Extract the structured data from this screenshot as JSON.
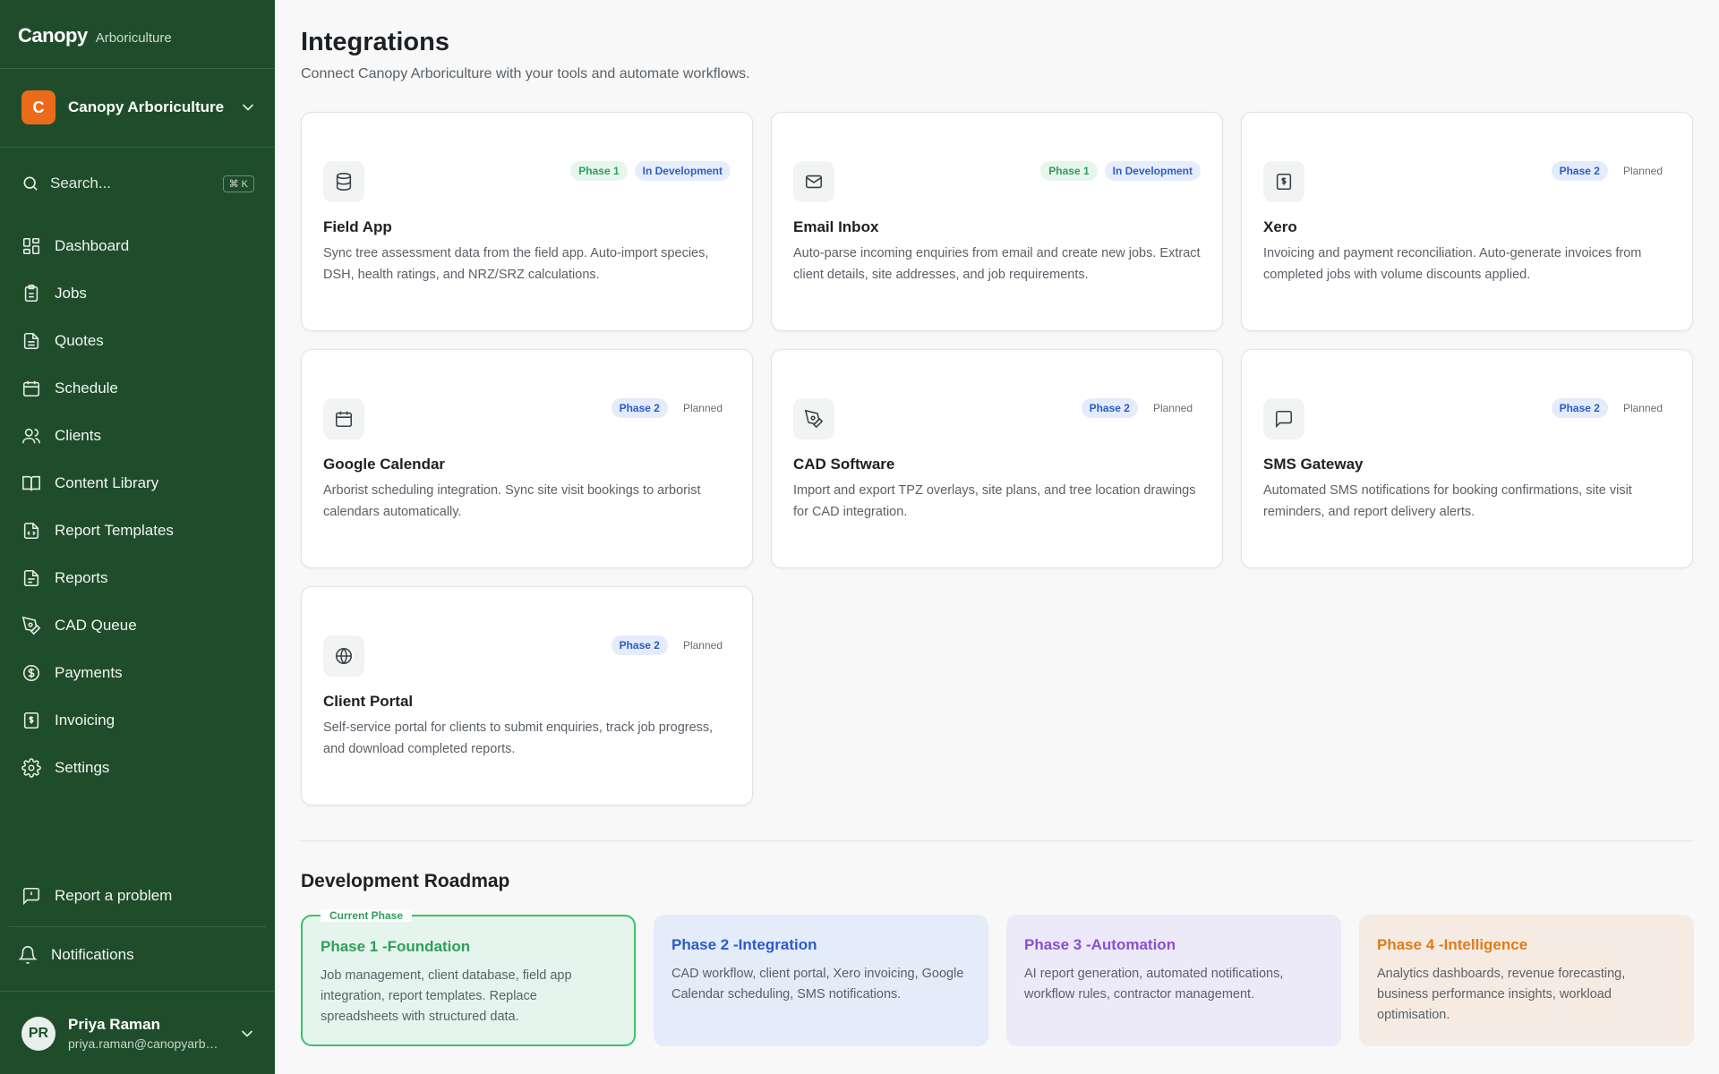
{
  "brand": {
    "name": "Canopy",
    "sub": "Arboriculture"
  },
  "org": {
    "initial": "C",
    "name": "Canopy Arboriculture"
  },
  "search": {
    "label": "Search...",
    "shortcut": "⌘ K"
  },
  "nav": [
    {
      "label": "Dashboard",
      "icon": "grid-icon"
    },
    {
      "label": "Jobs",
      "icon": "clipboard-icon"
    },
    {
      "label": "Quotes",
      "icon": "document-icon"
    },
    {
      "label": "Schedule",
      "icon": "calendar-icon"
    },
    {
      "label": "Clients",
      "icon": "users-icon"
    },
    {
      "label": "Content Library",
      "icon": "book-icon"
    },
    {
      "label": "Report Templates",
      "icon": "file-code-icon"
    },
    {
      "label": "Reports",
      "icon": "file-text-icon"
    },
    {
      "label": "CAD Queue",
      "icon": "pen-tool-icon"
    },
    {
      "label": "Payments",
      "icon": "dollar-circle-icon"
    },
    {
      "label": "Invoicing",
      "icon": "invoice-icon"
    },
    {
      "label": "Settings",
      "icon": "gear-icon"
    }
  ],
  "sidebar_footer": {
    "report_problem": "Report a problem",
    "notifications": "Notifications"
  },
  "user": {
    "initials": "PR",
    "name": "Priya Raman",
    "email": "priya.raman@canopyarboriculture.com"
  },
  "page": {
    "title": "Integrations",
    "subtitle": "Connect Canopy Arboriculture with your tools and automate workflows."
  },
  "integrations": [
    {
      "title": "Field App",
      "icon": "database-icon",
      "phase": "Phase 1",
      "status": "In Development",
      "desc": "Sync tree assessment data from the field app. Auto-import species, DSH, health ratings, and NRZ/SRZ calculations."
    },
    {
      "title": "Email Inbox",
      "icon": "mail-icon",
      "phase": "Phase 1",
      "status": "In Development",
      "desc": "Auto-parse incoming enquiries from email and create new jobs. Extract client details, site addresses, and job requirements."
    },
    {
      "title": "Xero",
      "icon": "invoice-icon",
      "phase": "Phase 2",
      "status": "Planned",
      "desc": "Invoicing and payment reconciliation. Auto-generate invoices from completed jobs with volume discounts applied."
    },
    {
      "title": "Google Calendar",
      "icon": "calendar-icon",
      "phase": "Phase 2",
      "status": "Planned",
      "desc": "Arborist scheduling integration. Sync site visit bookings to arborist calendars automatically."
    },
    {
      "title": "CAD Software",
      "icon": "pen-tool-icon",
      "phase": "Phase 2",
      "status": "Planned",
      "desc": "Import and export TPZ overlays, site plans, and tree location drawings for CAD integration."
    },
    {
      "title": "SMS Gateway",
      "icon": "message-icon",
      "phase": "Phase 2",
      "status": "Planned",
      "desc": "Automated SMS notifications for booking confirmations, site visit reminders, and report delivery alerts."
    },
    {
      "title": "Client Portal",
      "icon": "globe-icon",
      "phase": "Phase 2",
      "status": "Planned",
      "desc": "Self-service portal for clients to submit enquiries, track job progress, and download completed reports."
    }
  ],
  "roadmap": {
    "title": "Development Roadmap",
    "current_tag": "Current Phase",
    "phases": [
      {
        "title": "Phase 1 -Foundation",
        "desc": "Job management, client database, field app integration, report templates. Replace spreadsheets with structured data.",
        "color": "#2f9e5b",
        "bg": "#e5f4ec"
      },
      {
        "title": "Phase 2 -Integration",
        "desc": "CAD workflow, client portal, Xero invoicing, Google Calendar scheduling, SMS notifications.",
        "color": "#2c5cc5",
        "bg": "#e4ebf9"
      },
      {
        "title": "Phase 3 -Automation",
        "desc": "AI report generation, automated notifications, workflow rules, contractor management.",
        "color": "#8a4fd1",
        "bg": "#ece9f8"
      },
      {
        "title": "Phase 4 -Intelligence",
        "desc": "Analytics dashboards, revenue forecasting, business performance insights, workload optimisation.",
        "color": "#e07b16",
        "bg": "#f6ebe2"
      }
    ]
  }
}
